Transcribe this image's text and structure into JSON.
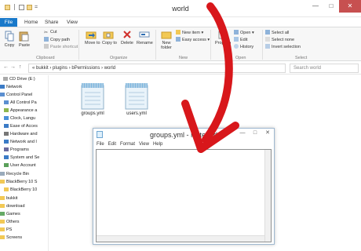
{
  "window": {
    "title": "world"
  },
  "qat": {
    "separator": "|",
    "dropdown": "="
  },
  "window_buttons": {
    "minimize": "—",
    "maximize": "□",
    "close": "✕"
  },
  "tabs": [
    "File",
    "Home",
    "Share",
    "View"
  ],
  "ribbon": {
    "copy": "Copy",
    "paste": "Paste",
    "cut": "Cut",
    "copy_path": "Copy path",
    "paste_shortcut": "Paste shortcut",
    "move_to": "Move to",
    "copy_to": "Copy to",
    "delete": "Delete",
    "rename": "Rename",
    "new_folder": "New folder",
    "new_item": "New item ▾",
    "easy_access": "Easy access ▾",
    "properties": "Properties",
    "open": "Open ▾",
    "edit": "Edit",
    "history": "History",
    "select_all": "Select all",
    "select_none": "Select none",
    "invert_selection": "Invert selection",
    "groups": {
      "clipboard": "Clipboard",
      "organize": "Organize",
      "new": "New",
      "open": "Open",
      "select": "Select"
    }
  },
  "address": {
    "path": "« bukkit › plugins › bPermissions › world",
    "search_placeholder": "Search world",
    "back": "←",
    "forward": "→",
    "up": "↑"
  },
  "navpane": {
    "items": [
      "CD Drive (E:)",
      "Network",
      "Control Panel",
      "All Control Pa",
      "Appearance a",
      "Clock, Langu",
      "Ease of Acces",
      "Hardware and",
      "Network and I",
      "Programs",
      "System and Se",
      "User Account",
      "Recycle Bin",
      "BlackBerry 10 S",
      "BlackBerry 10",
      "bukkit",
      "download",
      "Games",
      "Others",
      "PS",
      "Screens"
    ]
  },
  "files": [
    {
      "name": "groups.yml"
    },
    {
      "name": "users.yml"
    }
  ],
  "notepad": {
    "title": "groups.yml - Notepad",
    "menu": [
      "File",
      "Edit",
      "Format",
      "View",
      "Help"
    ],
    "buttons": {
      "minimize": "—",
      "maximize": "□",
      "close": "✕"
    }
  },
  "colors": {
    "file_tab": "#1979ca",
    "arrow": "#d8171b",
    "close": "#c75050"
  }
}
